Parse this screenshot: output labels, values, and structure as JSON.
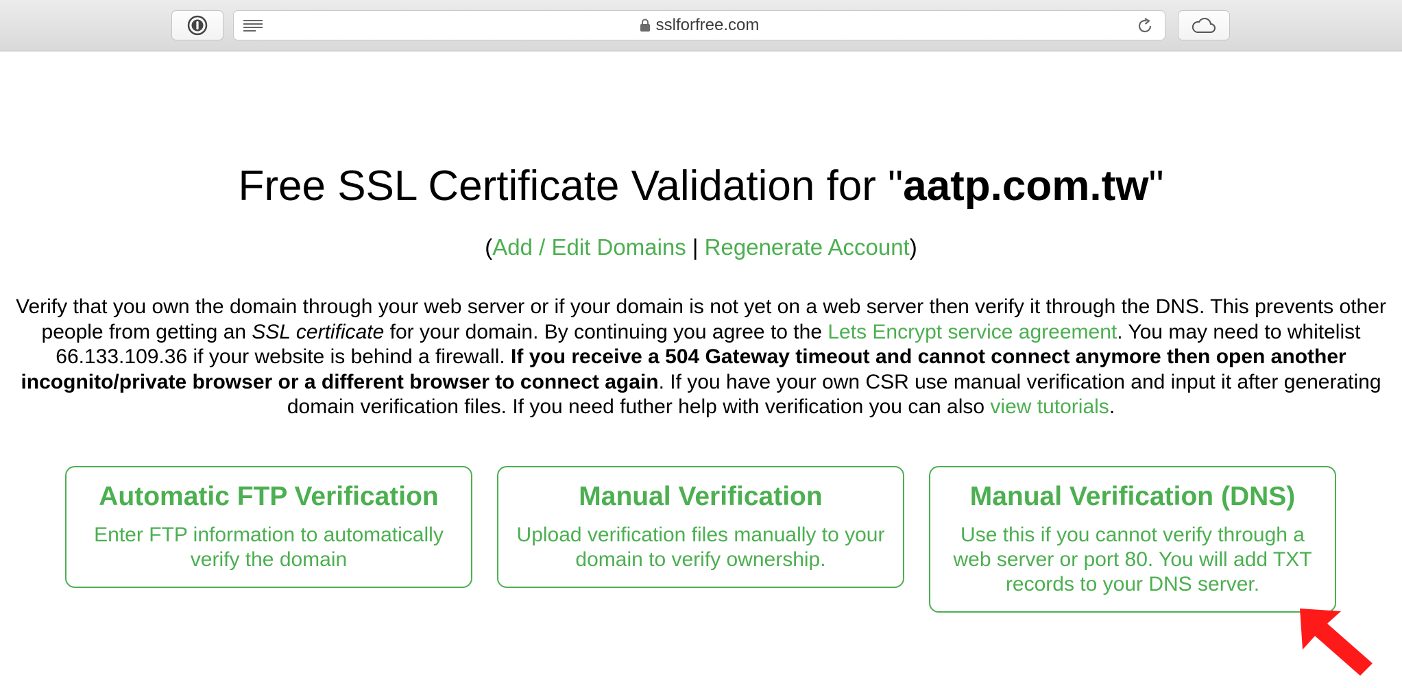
{
  "browser": {
    "url": "sslforfree.com"
  },
  "page": {
    "title_prefix": "Free SSL Certificate Validation for \"",
    "title_domain": "aatp.com.tw",
    "title_suffix": "\"",
    "links": {
      "open_paren": "(",
      "add_edit": "Add / Edit Domains",
      "separator": " | ",
      "regenerate": "Regenerate Account",
      "close_paren": ")"
    },
    "description": {
      "part1": "Verify that you own the domain through your web server or if your domain is not yet on a web server then verify it through the DNS. This prevents other people from getting an ",
      "ssl_italic": "SSL certificate",
      "part2": " for your domain. By continuing you agree to the ",
      "agreement_link": "Lets Encrypt service agreement",
      "part3": ". You may need to whitelist 66.133.109.36 if your website is behind a firewall. ",
      "bold_warning": "If you receive a 504 Gateway timeout and cannot connect anymore then open another incognito/private browser or a different browser to connect again",
      "part4": ". If you have your own CSR use manual verification and input it after generating domain verification files. If you need futher help with verification you can also ",
      "tutorials_link": "view tutorials",
      "part5": "."
    }
  },
  "cards": [
    {
      "title": "Automatic FTP Verification",
      "desc": "Enter FTP information to automatically verify the domain"
    },
    {
      "title": "Manual Verification",
      "desc": "Upload verification files manually to your domain to verify ownership."
    },
    {
      "title": "Manual Verification (DNS)",
      "desc": "Use this if you cannot verify through a web server or port 80. You will add TXT records to your DNS server."
    }
  ],
  "colors": {
    "accent_green": "#4caf50",
    "arrow_red": "#ff1a1a"
  },
  "icons": {
    "password_manager": "1password-icon",
    "reader": "reader-icon",
    "lock": "lock-icon",
    "reload": "reload-icon",
    "cloud": "cloud-icon",
    "annotation": "red-arrow-icon"
  }
}
